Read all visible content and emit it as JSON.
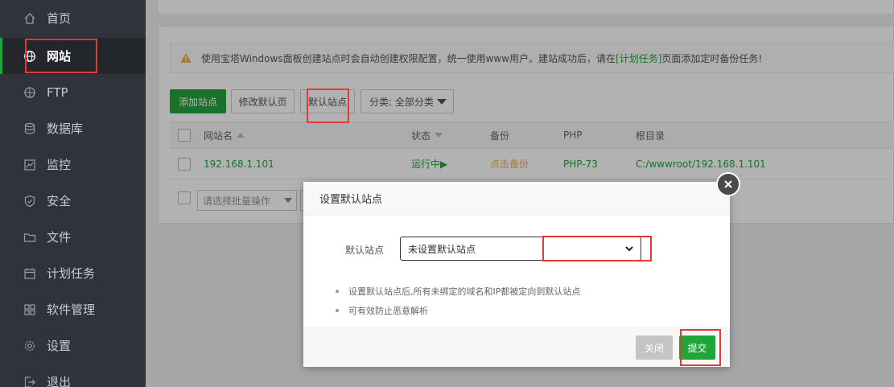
{
  "sidebar": {
    "items": [
      {
        "label": "首页",
        "icon": "home-icon"
      },
      {
        "label": "网站",
        "icon": "globe-icon",
        "active": true
      },
      {
        "label": "FTP",
        "icon": "ftp-icon"
      },
      {
        "label": "数据库",
        "icon": "database-icon"
      },
      {
        "label": "监控",
        "icon": "monitor-icon"
      },
      {
        "label": "安全",
        "icon": "shield-icon"
      },
      {
        "label": "文件",
        "icon": "folder-icon"
      },
      {
        "label": "计划任务",
        "icon": "calendar-icon"
      },
      {
        "label": "软件管理",
        "icon": "grid-icon"
      },
      {
        "label": "设置",
        "icon": "gear-icon"
      },
      {
        "label": "退出",
        "icon": "logout-icon"
      }
    ]
  },
  "notice": {
    "text_before": "使用宝塔Windows面板创建站点时会自动创建权限配置，统一使用www用户。建站成功后，请在",
    "link": "[计划任务]",
    "text_after": "页面添加定时备份任务!"
  },
  "toolbar": {
    "add_site": "添加站点",
    "edit_default_page": "修改默认页",
    "default_site": "默认站点",
    "category": "分类: 全部分类"
  },
  "table": {
    "headers": {
      "name": "网站名",
      "status": "状态",
      "backup": "备份",
      "php": "PHP",
      "root": "根目录"
    },
    "rows": [
      {
        "name": "192.168.1.101",
        "status": "运行中▶",
        "backup": "点击备份",
        "php": "PHP-73",
        "root": "C:/wwwroot/192.168.1.101"
      }
    ]
  },
  "batch": {
    "placeholder": "请选择批量操作"
  },
  "modal": {
    "title": "设置默认站点",
    "field_label": "默认站点",
    "select_value": "未设置默认站点",
    "tips": [
      "设置默认站点后,所有未绑定的域名和IP都被定向到默认站点",
      "可有效防止恶意解析"
    ],
    "close_button": "关闭",
    "submit_button": "提交"
  },
  "colors": {
    "brand_green": "#20a53a",
    "sidebar_bg": "#30343a",
    "highlight_red": "#e53935",
    "warning_orange": "#f0ad4e"
  }
}
